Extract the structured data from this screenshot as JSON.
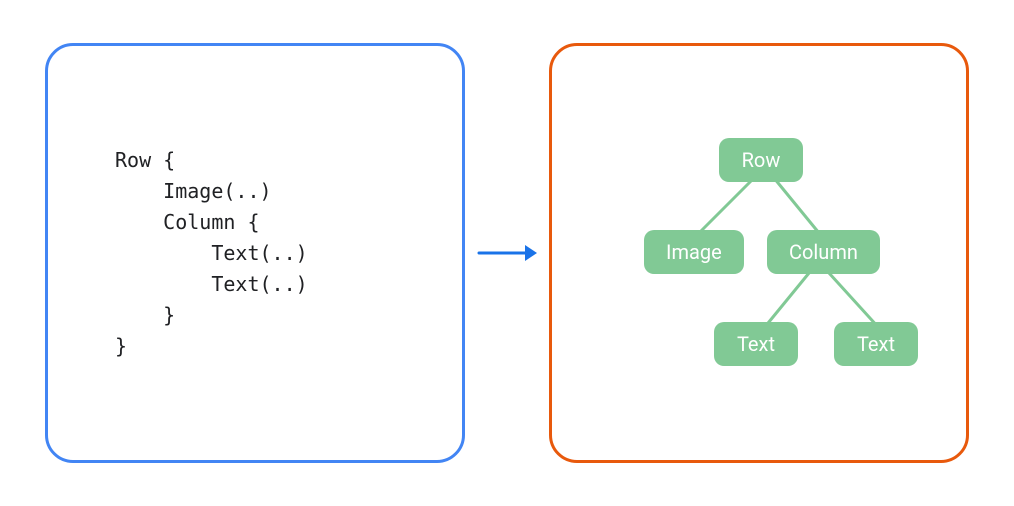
{
  "code": {
    "indent": "    ",
    "lines": [
      "Row {",
      "    Image(..)",
      "    Column {",
      "        Text(..)",
      "        Text(..)",
      "    }",
      "}"
    ]
  },
  "tree": {
    "root": "Row",
    "left_child1": "Image",
    "left_child2": "Column",
    "leaf1": "Text",
    "leaf2": "Text"
  },
  "colors": {
    "left_border": "#4285f4",
    "right_border": "#e8590c",
    "node_fill": "#81c995",
    "arrow": "#1a73e8"
  },
  "icon_names": {
    "arrow": "arrow-right-icon"
  }
}
